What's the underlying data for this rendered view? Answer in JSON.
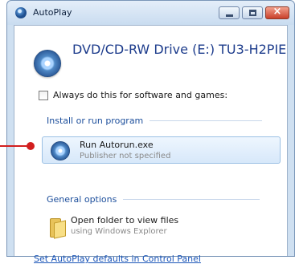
{
  "window": {
    "title": "AutoPlay",
    "controls": [
      "minimize",
      "maximize",
      "close"
    ]
  },
  "drive": {
    "title": "DVD/CD-RW Drive (E:) TU3-H2PIE",
    "icon": "disc-icon"
  },
  "always": {
    "label": "Always do this for software and games:",
    "checked": false
  },
  "install_section": {
    "header": "Install or run program",
    "items": [
      {
        "title": "Run Autorun.exe",
        "subtitle": "Publisher not specified",
        "icon": "disc-icon",
        "highlighted": true
      }
    ]
  },
  "general_section": {
    "header": "General options",
    "items": [
      {
        "title": "Open folder to view files",
        "subtitle": "using Windows Explorer",
        "icon": "folder-icon"
      }
    ]
  },
  "footer": {
    "link": "Set AutoPlay defaults in Control Panel"
  },
  "colors": {
    "accent": "#1d4f9c",
    "link": "#1b55b8",
    "callout": "#d21f1f"
  }
}
